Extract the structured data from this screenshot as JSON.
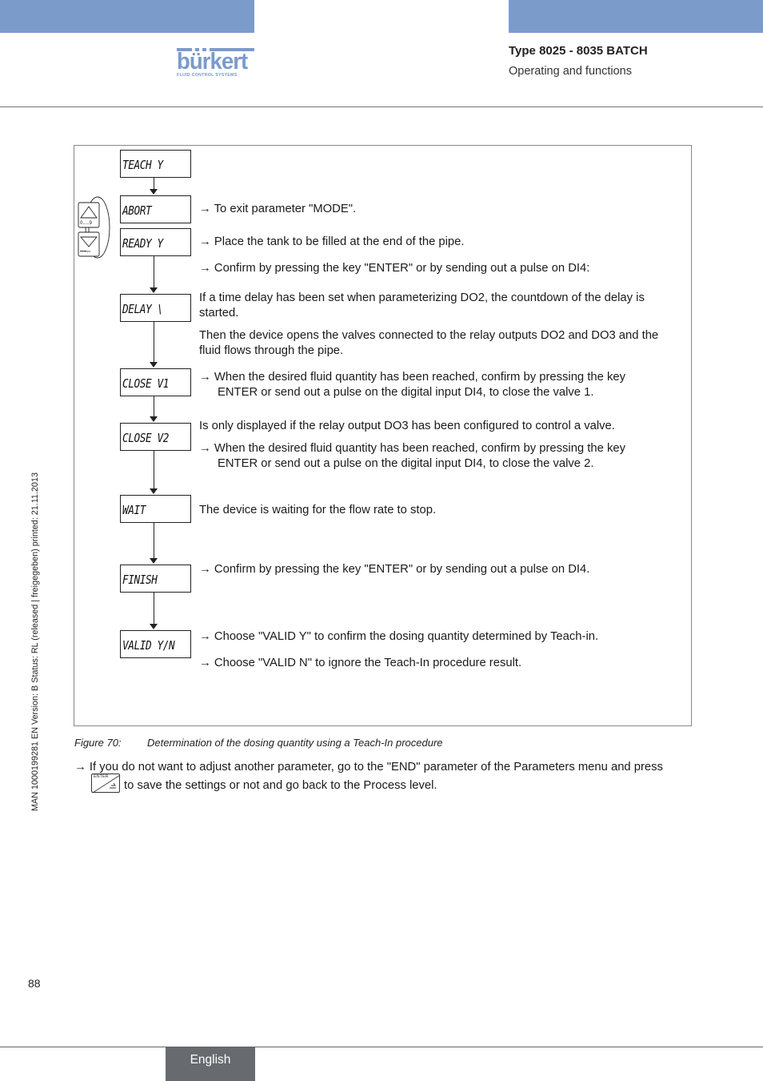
{
  "header": {
    "brand": "bürkert",
    "brand_tagline": "FLUID CONTROL SYSTEMS",
    "title": "Type 8025 - 8035 BATCH",
    "subtitle": "Operating and functions",
    "band_color": "#7b9bcb"
  },
  "sidebar": {
    "doc_info": "MAN  1000199281  EN  Version: B  Status: RL (released | freigegeben)  printed: 21.11.2013"
  },
  "figure": {
    "keypad": {
      "up_key_label": "0.....9",
      "down_key_label": "•••• ⇦"
    },
    "displays": [
      {
        "id": "teach",
        "text": "TEACH Y"
      },
      {
        "id": "abort",
        "text": "ABORT"
      },
      {
        "id": "ready",
        "text": "READY Y"
      },
      {
        "id": "delay",
        "text": "DELAY \\"
      },
      {
        "id": "close-v1",
        "text": "CLOSE V1"
      },
      {
        "id": "close-v2",
        "text": "CLOSE V2"
      },
      {
        "id": "wait",
        "text": "WAIT"
      },
      {
        "id": "finish",
        "text": "FINISH"
      },
      {
        "id": "valid",
        "text": "VALID Y/N"
      }
    ],
    "descriptions": {
      "abort": "→ To exit parameter \"MODE\".",
      "ready_1": "→  Place the tank to be filled at the end of the pipe.",
      "ready_2": "→ Confirm by pressing the key \"ENTER\" or by sending out a pulse on DI4:",
      "delay_1a": "If a time delay has been set when parameterizing DO2, the countdown of the delay is",
      "delay_1b": "started.",
      "delay_2a": "Then the device opens the valves connected to the relay outputs DO2 and DO3 and the",
      "delay_2b": "fluid flows through the pipe.",
      "close_v1_a": "→ When the desired fluid quantity has been reached, confirm by pressing the key",
      "close_v1_b": "ENTER or send out a pulse on the digital input DI4, to close the valve 1.",
      "close_v2_note": "Is only displayed if the relay output DO3 has been configured to control a valve.",
      "close_v2_a": "→ When the desired fluid quantity has been reached, confirm by pressing the key",
      "close_v2_b": "ENTER or send out a pulse on the digital input DI4, to close the valve 2.",
      "wait": "The device is waiting for the flow rate to stop.",
      "finish": "→ Confirm by pressing the key \"ENTER\" or by sending out a pulse on DI4.",
      "valid_1": "→ Choose \"VALID Y\" to confirm the dosing quantity determined by Teach-in.",
      "valid_2": "→ Choose \"VALID N\" to ignore the Teach-In procedure result."
    },
    "caption_number": "Figure 70:",
    "caption_text": "Determination of the dosing quantity using a Teach-In procedure"
  },
  "instruction": {
    "line1": "→ If you do not want to adjust another parameter, go to the \"END\" parameter of the Parameters menu and press",
    "line2": "to save the settings or not and go back to the Process level.",
    "enter_key_label": "ENTER"
  },
  "footer": {
    "page_number": "88",
    "language": "English"
  }
}
